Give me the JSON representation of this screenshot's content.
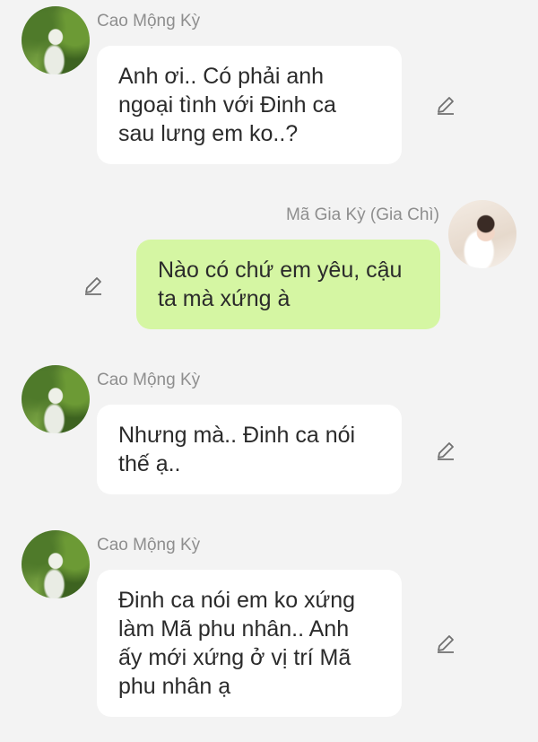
{
  "messages": [
    {
      "sender": "Cao Mộng Kỳ",
      "side": "left",
      "text": "Anh ơi.. Có phải anh\nngoại tình với Đinh ca\nsau lưng em ko..?",
      "action_icon": "edit-icon"
    },
    {
      "sender": "Mã Gia Kỳ (Gia Chì)",
      "side": "right",
      "text": "Nào có chứ em yêu, cậu\nta mà xứng à",
      "action_icon": "edit-icon"
    },
    {
      "sender": "Cao Mộng Kỳ",
      "side": "left",
      "text": "Nhưng mà.. Đinh ca nói\nthế ạ..",
      "action_icon": "edit-icon"
    },
    {
      "sender": "Cao Mộng Kỳ",
      "side": "left",
      "text": "Đinh ca nói em ko xứng\nlàm Mã phu nhân.. Anh\nấy mới xứng ở vị trí Mã\nphu nhân ạ",
      "action_icon": "edit-icon"
    }
  ],
  "colors": {
    "background": "#f3f3f3",
    "incoming_bubble": "#ffffff",
    "outgoing_bubble": "#d5f6a3",
    "name_text": "#8e8e8e"
  }
}
